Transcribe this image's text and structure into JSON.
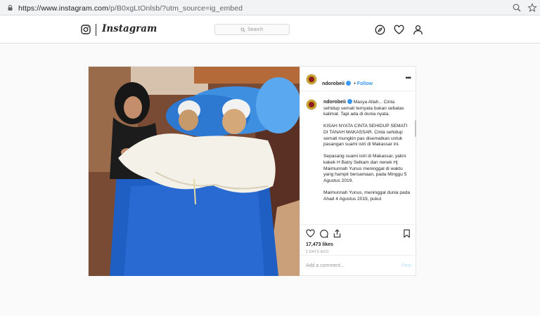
{
  "browser": {
    "url_host": "https://www.instagram.com",
    "url_path": "/p/B0xgLtOnlsb/?utm_source=ig_embed",
    "icons": [
      "lock-icon",
      "zoom-icon",
      "star-icon"
    ]
  },
  "header": {
    "brand": "Instagram",
    "search_placeholder": "Search",
    "icons": [
      "instagram-glyph-icon",
      "explore-compass-icon",
      "heart-icon",
      "profile-icon"
    ]
  },
  "post": {
    "username": "ndorobeii",
    "follow_label": "Follow",
    "more_label": "•••",
    "caption": {
      "username": "ndorobeii",
      "paragraphs": [
        "Masya Allah... Cinta sehidup semati ternyata bukan sebatas kalimat. Tapi ada di dunia nyata.",
        "KISAH NYATA CINTA SEHIDUP SEMATI DI TANAH MAKASSAR. Cinta sehidup semati mungkin pas disematkan untuk pasangan suami istri di Makassar ini.",
        "Sepasang suami istri di Makassar, yakni kakek H Batry Selkam dan nenek Hj Maimunnah Yunus meninggal di waktu yang hampir bersamaan, pada Minggu 5 Agustus 2019.",
        "Maimunnah Yunus, meninggal dunia pada Ahad 4 Agustus 2019, pukul"
      ]
    },
    "likes": "17,473 likes",
    "date": "2 DAYS AGO",
    "comment_placeholder": "Add a comment...",
    "post_label": "Post"
  },
  "colors": {
    "accent_blue": "#3897f0",
    "verified": "#3897f0",
    "border": "#dbdbdb"
  }
}
